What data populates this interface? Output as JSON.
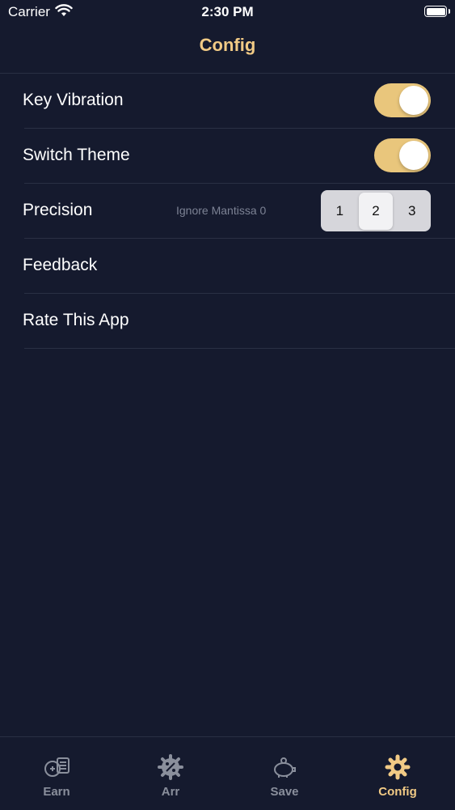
{
  "status_bar": {
    "carrier": "Carrier",
    "time": "2:30 PM"
  },
  "nav": {
    "title": "Config"
  },
  "colors": {
    "accent": "#f1ca85",
    "toggle_on": "#e9c67c",
    "background": "#151a2e",
    "inactive": "#8a8f9c"
  },
  "settings": {
    "key_vibration": {
      "label": "Key Vibration",
      "on": true
    },
    "switch_theme": {
      "label": "Switch Theme",
      "on": true
    },
    "precision": {
      "label": "Precision",
      "hint": "Ignore Mantissa 0",
      "options": [
        "1",
        "2",
        "3"
      ],
      "selected": "2"
    },
    "feedback": {
      "label": "Feedback"
    },
    "rate": {
      "label": "Rate This App"
    }
  },
  "tabs": [
    {
      "label": "Earn",
      "icon": "earn-icon"
    },
    {
      "label": "Arr",
      "icon": "percent-gear-icon"
    },
    {
      "label": "Save",
      "icon": "piggy-bank-icon"
    },
    {
      "label": "Config",
      "icon": "gear-icon",
      "active": true
    }
  ]
}
